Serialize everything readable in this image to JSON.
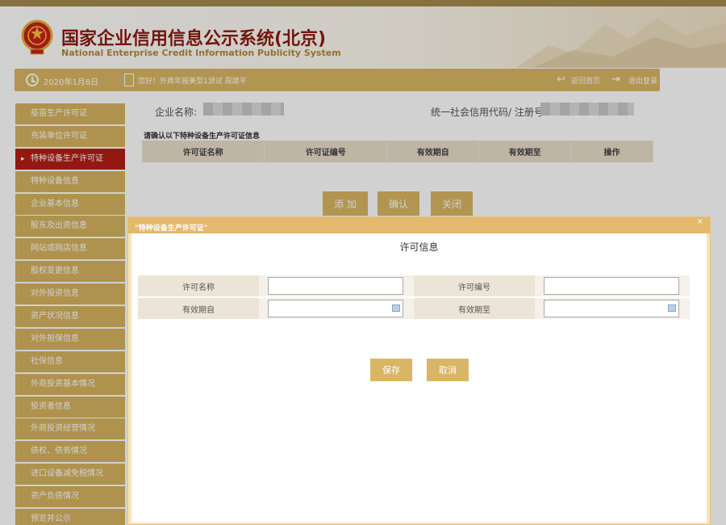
{
  "header": {
    "title_cn": "国家企业信用信息公示系统(北京)",
    "title_en": "National Enterprise Credit Information Publicity System"
  },
  "toolbar": {
    "date": "2020年1月8日",
    "greeting": "您好！外商年报美型1测试   周建平",
    "home_label": "返回首页",
    "logout_label": "退出登录"
  },
  "sidebar": {
    "items": [
      {
        "label": "疫苗生产许可证"
      },
      {
        "label": "充装单位许可证"
      },
      {
        "label": "特种设备生产许可证"
      },
      {
        "label": "特种设备信息"
      },
      {
        "label": "企业基本信息"
      },
      {
        "label": "股东及出资信息"
      },
      {
        "label": "网站或网店信息"
      },
      {
        "label": "股权变更信息"
      },
      {
        "label": "对外投资信息"
      },
      {
        "label": "资产状况信息"
      },
      {
        "label": "对外担保信息"
      },
      {
        "label": "社保信息"
      },
      {
        "label": "外商投资基本情况"
      },
      {
        "label": "投资者信息"
      },
      {
        "label": "外商投资经营情况"
      },
      {
        "label": "债权、债务情况"
      },
      {
        "label": "进口设备减免税情况"
      },
      {
        "label": "资产负债情况"
      },
      {
        "label": "预览并公示"
      }
    ]
  },
  "main": {
    "company_name_label": "企业名称:",
    "credit_code_label": "统一社会信用代码/ 注册号:",
    "table_caption": "请确认以下特种设备生产许可证信息",
    "columns": [
      "许可证名称",
      "许可证编号",
      "有效期自",
      "有效期至",
      "操作"
    ],
    "buttons": {
      "add": "添 加",
      "confirm": "确认",
      "close": "关闭"
    }
  },
  "modal": {
    "title": "\"特种设备生产许可证\"",
    "close_glyph": "×",
    "section_title": "许可信息",
    "fields": {
      "name_label": "许可名称",
      "name_value": "",
      "number_label": "许可编号",
      "number_value": "",
      "valid_from_label": "有效期自",
      "valid_from_value": "",
      "valid_to_label": "有效期至",
      "valid_to_value": ""
    },
    "save_label": "保存",
    "cancel_label": "取消"
  },
  "colors": {
    "gold": "#d9b663",
    "active_red": "#b41e17",
    "title_red": "#8b1a10"
  }
}
